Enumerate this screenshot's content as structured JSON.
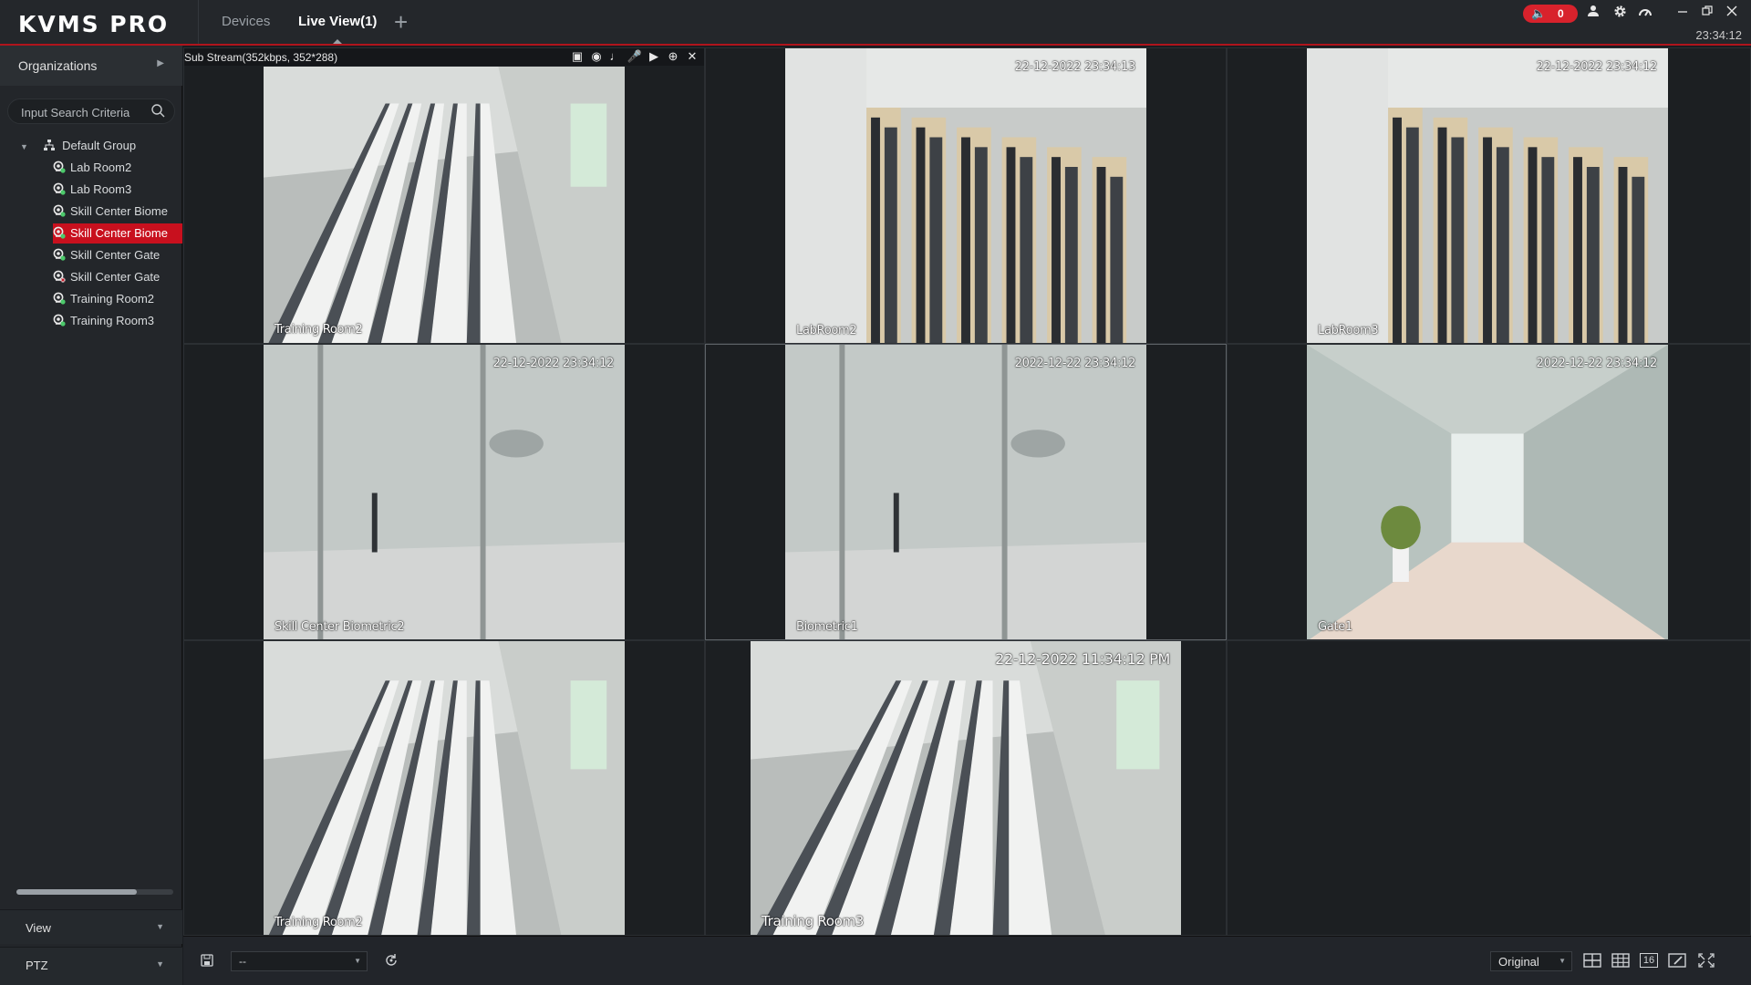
{
  "app": {
    "logo": "KVMS PRO",
    "clock": "23:34:12"
  },
  "tabs": [
    {
      "label": "Devices"
    },
    {
      "label": "Live View(1)"
    }
  ],
  "tab_add": "+",
  "alarm": {
    "count": "0",
    "color": "#d8222c"
  },
  "top_icons": [
    "speaker-icon",
    "user-icon",
    "gear-icon",
    "performance-gauge-icon",
    "minimize-icon",
    "restore-icon",
    "close-icon"
  ],
  "sidebar": {
    "organizations_label": "Organizations",
    "search": {
      "placeholder": "Input Search Criteria",
      "value": ""
    },
    "tree": {
      "root": "Default Group",
      "items": [
        {
          "label": "Lab Room2",
          "selected": false,
          "status": "online"
        },
        {
          "label": "Lab Room3",
          "selected": false,
          "status": "online"
        },
        {
          "label": "Skill Center Biome",
          "selected": false,
          "status": "online"
        },
        {
          "label": "Skill Center Biome",
          "selected": true,
          "status": "online"
        },
        {
          "label": "Skill Center Gate",
          "selected": false,
          "status": "online"
        },
        {
          "label": "Skill Center Gate",
          "selected": false,
          "status": "offline"
        },
        {
          "label": "Training Room2",
          "selected": false,
          "status": "online"
        },
        {
          "label": "Training Room3",
          "selected": false,
          "status": "online"
        }
      ]
    },
    "view_label": "View",
    "ptz_label": "PTZ"
  },
  "live": {
    "stream_info": "Sub Stream(352kbps, 352*288)",
    "stream_icons": [
      "fisheye-icon",
      "snapshot-icon",
      "audio-icon",
      "talk-icon",
      "record-icon",
      "zoom-icon",
      "close-icon"
    ],
    "cells": [
      {
        "timestamp": "",
        "label": "Training Room2",
        "scene": "classroom"
      },
      {
        "timestamp": "22-12-2022 23:34:13",
        "label": "LabRoom2",
        "scene": "lab"
      },
      {
        "timestamp": "22-12-2022 23:34:12",
        "label": "LabRoom3",
        "scene": "lab"
      },
      {
        "timestamp": "22-12-2022 23:34:12",
        "label": "Skill Center Biometric2",
        "scene": "door"
      },
      {
        "timestamp": "2022-12-22 23:34:12",
        "label": "Biometric1",
        "scene": "door"
      },
      {
        "timestamp": "2022-12-22 23:34:12",
        "label": "Gate1",
        "scene": "corridor"
      },
      {
        "timestamp": "",
        "label": "Training Room2",
        "scene": "classroom"
      },
      {
        "timestamp": "22-12-2022 11:34:12 PM",
        "label": "Training Room3",
        "scene": "classroom"
      },
      {
        "timestamp": "",
        "label": "",
        "scene": "empty"
      }
    ]
  },
  "bottom": {
    "preset_value": "--",
    "mode_value": "Original",
    "layout_icons": [
      "layout-4-icon",
      "layout-9-icon",
      "layout-16-icon",
      "custom-layout-icon",
      "fullscreen-icon"
    ],
    "layout_16_label": "16"
  }
}
